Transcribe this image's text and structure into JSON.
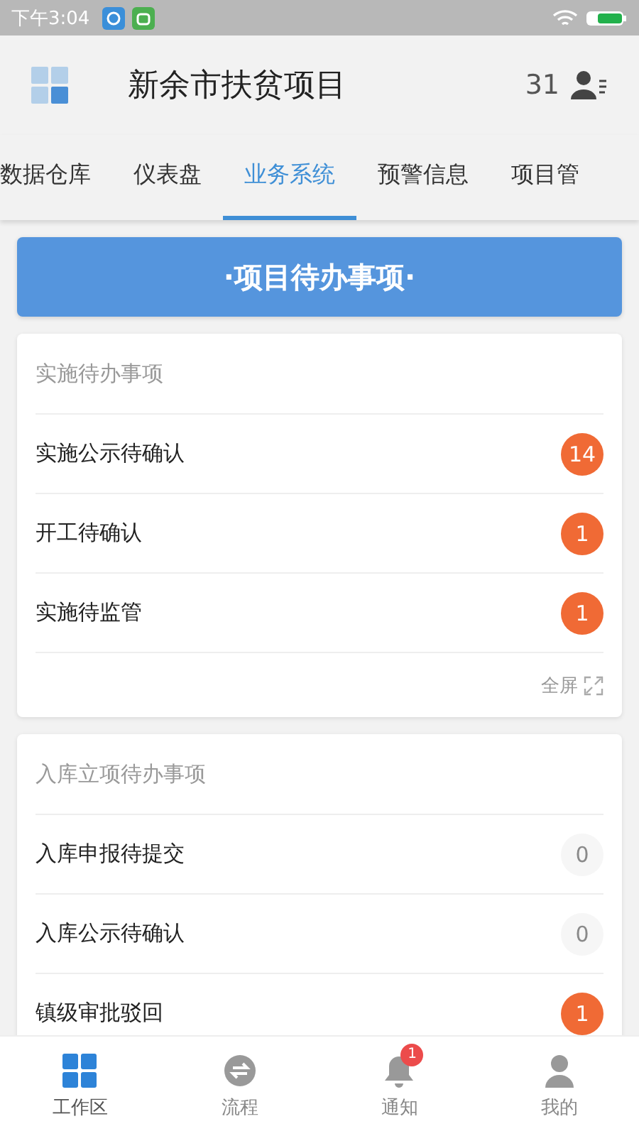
{
  "status_bar": {
    "time": "下午3:04"
  },
  "header": {
    "title": "新余市扶贫项目",
    "count": "31"
  },
  "tabs": [
    {
      "label": "数据仓库",
      "selected": false
    },
    {
      "label": "仪表盘",
      "selected": false
    },
    {
      "label": "业务系统",
      "selected": true
    },
    {
      "label": "预警信息",
      "selected": false
    },
    {
      "label": "项目管",
      "selected": false
    }
  ],
  "banner": "·项目待办事项·",
  "cards": [
    {
      "title": "实施待办事项",
      "items": [
        {
          "label": "实施公示待确认",
          "count": "14",
          "highlighted": true
        },
        {
          "label": "开工待确认",
          "count": "1",
          "highlighted": true
        },
        {
          "label": "实施待监管",
          "count": "1",
          "highlighted": true
        }
      ],
      "footer": "全屏"
    },
    {
      "title": "入库立项待办事项",
      "items": [
        {
          "label": "入库申报待提交",
          "count": "0",
          "highlighted": false
        },
        {
          "label": "入库公示待确认",
          "count": "0",
          "highlighted": false
        },
        {
          "label": "镇级审批驳回",
          "count": "1",
          "highlighted": true
        }
      ]
    }
  ],
  "bottom_nav": [
    {
      "kind": "grid",
      "label": "工作区",
      "selected": true
    },
    {
      "kind": "flow",
      "label": "流程",
      "selected": false
    },
    {
      "kind": "bell",
      "label": "通知",
      "selected": false,
      "badge": "1"
    },
    {
      "kind": "person",
      "label": "我的",
      "selected": false
    }
  ]
}
